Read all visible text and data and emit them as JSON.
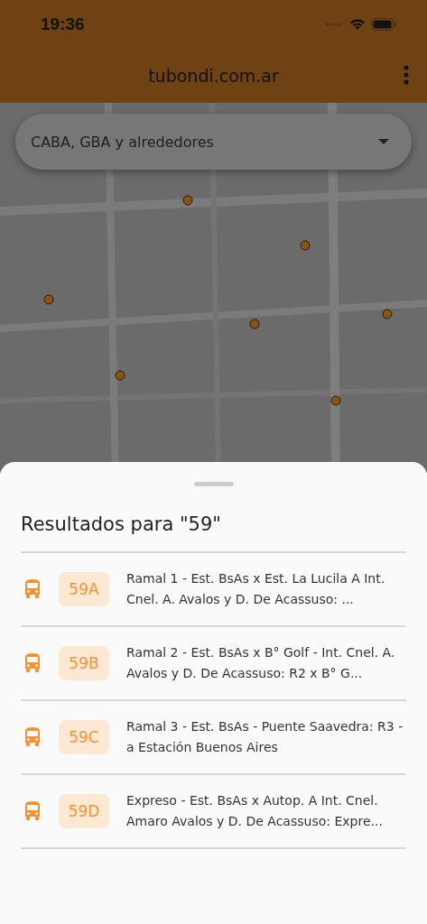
{
  "status_bar": {
    "time": "19:36"
  },
  "header": {
    "title": "tubondi.com.ar"
  },
  "region_select": {
    "value": "CABA, GBA y alrededores"
  },
  "results": {
    "title": "Resultados para \"59\"",
    "routes": [
      {
        "code": "59A",
        "description": "Ramal 1 - Est. BsAs x Est. La Lucila A Int. Cnel. A. Avalos y D. De Acassuso: ..."
      },
      {
        "code": "59B",
        "description": "Ramal 2 - Est. BsAs x B° Golf - Int. Cnel. A. Avalos y D. De Acassuso: R2 x B° G..."
      },
      {
        "code": "59C",
        "description": "Ramal 3 - Est. BsAs - Puente Saavedra: R3 - a Estación Buenos Aires"
      },
      {
        "code": "59D",
        "description": "Expreso - Est. BsAs x Autop. A Int. Cnel. Amaro Avalos y D. De Acassuso: Expre..."
      }
    ]
  }
}
